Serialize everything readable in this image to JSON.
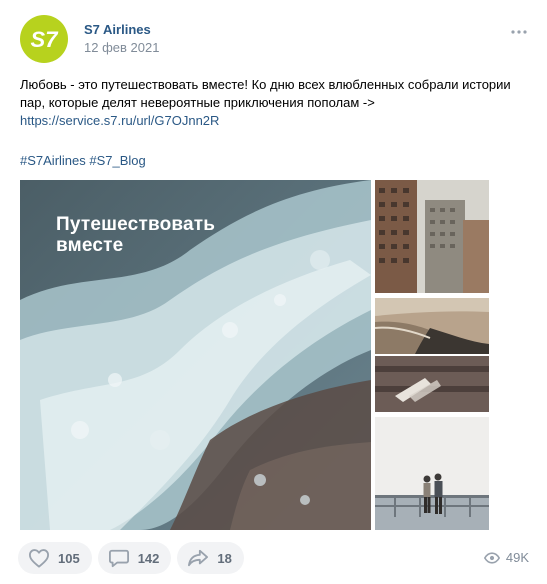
{
  "post": {
    "author": "S7 Airlines",
    "date": "12 фев 2021",
    "avatar_label": "S7",
    "text_line1": "Любовь - это путешествовать вместе! Ко дню всех влюбленных собрали истории",
    "text_line2": "пар, которые делят невероятные приключения пополам ->",
    "link": "https://service.s7.ru/url/G7OJnn2R",
    "hashtags": [
      "#S7Airlines",
      "#S7_Blog"
    ],
    "image_caption_line1": "Путешествовать",
    "image_caption_line2": "вместе"
  },
  "footer": {
    "likes": "105",
    "comments": "142",
    "shares": "18",
    "views": "49K"
  },
  "colors": {
    "link": "#2a5885",
    "brand": "#b7d21e",
    "muted": "#818c99",
    "pill_bg": "#f2f3f5"
  },
  "icons": [
    "more-dots-icon",
    "heart-icon",
    "comment-icon",
    "share-icon",
    "eye-icon"
  ]
}
